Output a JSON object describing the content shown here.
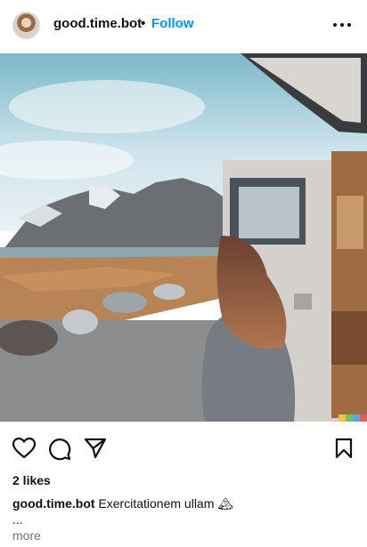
{
  "post": {
    "username": "good.time.bot",
    "separator": "•",
    "follow_label": "Follow",
    "more_icon": "more-horizontal-icon",
    "photo_subject": "woman sitting by camper van facing mountains and lake"
  },
  "actions": {
    "like_icon": "heart-icon",
    "comment_icon": "comment-icon",
    "share_icon": "send-icon",
    "save_icon": "bookmark-icon"
  },
  "likes_text": "2 likes",
  "caption": {
    "username": "good.time.bot",
    "text": "Exercitationem ullam",
    "emoji": "🏔",
    "ellipsis": "...",
    "more_label": "more"
  },
  "colors": {
    "follow": "#0095f6",
    "muted": "#737373"
  }
}
